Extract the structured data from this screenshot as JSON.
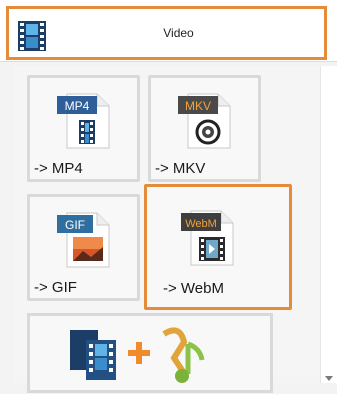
{
  "header": {
    "title": "Video",
    "icon": "film-icon"
  },
  "tiles": [
    {
      "badge": "MP4",
      "label": "-> MP4",
      "badge_color": "#2e5f99"
    },
    {
      "badge": "MKV",
      "label": "-> MKV",
      "badge_color": "#4a4a4a"
    },
    {
      "badge": "GIF",
      "label": "-> GIF",
      "badge_color": "#2f6f9f"
    },
    {
      "badge": "WebM",
      "label": "-> WebM",
      "badge_color": "#3f3f3f"
    }
  ],
  "colors": {
    "accent": "#e58c3b"
  }
}
